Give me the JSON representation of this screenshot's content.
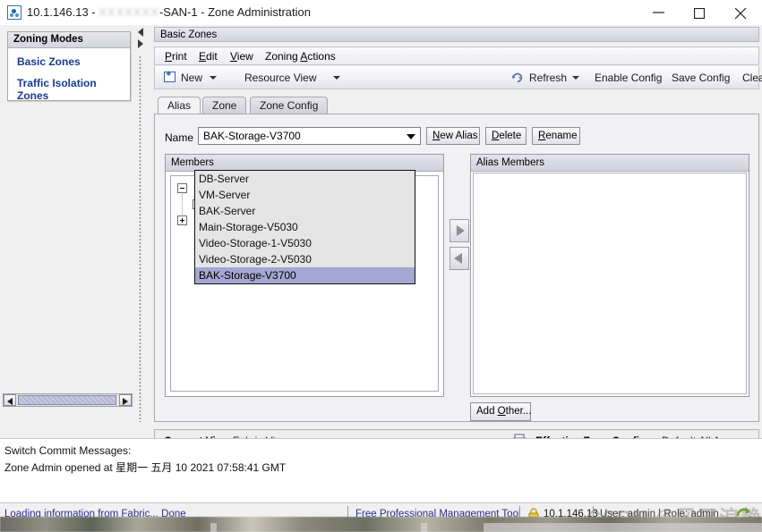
{
  "window": {
    "title_prefix": "10.1.146.13 - ",
    "title_blurred": "XXXXXXX",
    "title_suffix": "-SAN-1 - Zone Administration",
    "icon": "switch-app-icon",
    "minimize": "–",
    "maximize": "□",
    "close": "✕"
  },
  "left_panel": {
    "header": "Zoning Modes",
    "items": [
      {
        "label": "Basic Zones"
      },
      {
        "label": "Traffic Isolation Zones"
      }
    ]
  },
  "main": {
    "panel_title": "Basic Zones",
    "menu": [
      {
        "label": "Print",
        "mnemonic": "P"
      },
      {
        "label": "Edit",
        "mnemonic": "E"
      },
      {
        "label": "View",
        "mnemonic": "V"
      },
      {
        "label": "Zoning Actions",
        "mnemonic": "A"
      }
    ],
    "toolbar": {
      "new_label": "New",
      "resource_view_label": "Resource View",
      "refresh_label": "Refresh",
      "enable_config_label": "Enable Config",
      "save_config_label": "Save Config",
      "clear_all_label": "Clear All"
    },
    "tabs": [
      {
        "label": "Alias",
        "active": true
      },
      {
        "label": "Zone",
        "active": false
      },
      {
        "label": "Zone Config",
        "active": false
      }
    ],
    "name_label": "Name",
    "name_value": "BAK-Storage-V3700",
    "buttons": {
      "new_alias": "New Alias",
      "new_alias_mnemonic": "N",
      "delete": "Delete",
      "delete_mnemonic": "D",
      "rename": "Rename",
      "rename_mnemonic": "R",
      "add_other": "Add Other...",
      "add_other_mnemonic": "O"
    },
    "members_header": "Members",
    "alias_members_header": "Alias Members",
    "members_tree": [
      {
        "icon": "switch-node-icon",
        "toggle": "minus"
      },
      {
        "icon": "switch-child-icon",
        "toggle": "plus"
      },
      {
        "icon": "globe-node-icon",
        "toggle": "plus"
      }
    ],
    "transfer": {
      "add_arrow": "add-member-arrow",
      "remove_arrow": "remove-member-arrow"
    },
    "status": {
      "current_view_label": "Current View:",
      "current_view_value": "Fabric View",
      "effective_zone_config_label": "Effective Zone Config:",
      "effective_zone_config_value": "Default,All Access",
      "printer_icon": "printer-icon"
    }
  },
  "dropdown": {
    "open": true,
    "options": [
      {
        "label": "DB-Server",
        "selected": false
      },
      {
        "label": "VM-Server",
        "selected": false
      },
      {
        "label": "BAK-Server",
        "selected": false
      },
      {
        "label": "Main-Storage-V5030",
        "selected": false
      },
      {
        "label": "Video-Storage-1-V5030",
        "selected": false
      },
      {
        "label": "Video-Storage-2-V5030",
        "selected": false
      },
      {
        "label": "BAK-Storage-V3700",
        "selected": true
      }
    ]
  },
  "messages": {
    "line1": "Switch Commit Messages:",
    "line2": "Zone Admin opened at 星期一 五月 10 2021 07:58:41 GMT"
  },
  "statusbar": {
    "loading_text": "Loading information from Fabric... Done",
    "free_tool_link": "Free Professional Management Tool",
    "lock_icon": "lock-icon",
    "ip_address": "10.1.146.13",
    "user_role": "User: admin  |  Role: admin",
    "refresh_icon": "refresh-icon",
    "watermark": "CSDN @风平浪静"
  },
  "colors": {
    "link": "#2b2b8f",
    "selection": "#a6a6d2",
    "panel_header": "#d2d2dd"
  }
}
